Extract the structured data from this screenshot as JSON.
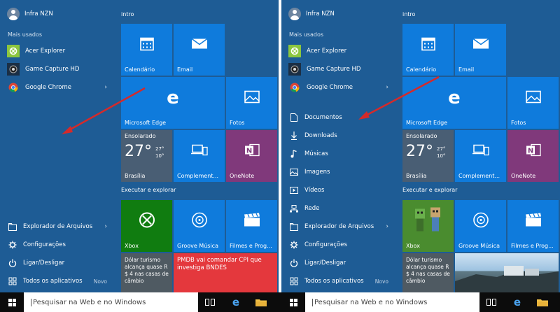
{
  "user": {
    "name": "Infra NZN"
  },
  "most_used_label": "Mais usados",
  "apps": [
    {
      "label": "Acer Explorer",
      "icon": "acer-explorer-icon",
      "color": "#8cc63f"
    },
    {
      "label": "Game Capture HD",
      "icon": "game-capture-icon",
      "color": "#1a1a1a"
    },
    {
      "label": "Google Chrome",
      "icon": "chrome-icon",
      "color": "#ffffff"
    }
  ],
  "chevron": "›",
  "places": [
    {
      "label": "Documentos",
      "icon": "document-icon"
    },
    {
      "label": "Downloads",
      "icon": "download-icon"
    },
    {
      "label": "Músicas",
      "icon": "music-icon"
    },
    {
      "label": "Imagens",
      "icon": "image-icon"
    },
    {
      "label": "Vídeos",
      "icon": "video-icon"
    },
    {
      "label": "Rede",
      "icon": "network-icon"
    }
  ],
  "bottom_menu": {
    "file_explorer": "Explorador de Arquivos",
    "settings": "Configurações",
    "power": "Ligar/Desligar",
    "all_apps": "Todos os aplicativos",
    "new_tag": "Novo"
  },
  "tile_groups": {
    "intro": "intro",
    "explore": "Executar e explorar"
  },
  "tiles": {
    "calendar": "Calendário",
    "email": "Email",
    "edge": "Microsoft Edge",
    "photos": "Fotos",
    "complement": "Complement...",
    "onenote": "OneNote",
    "xbox": "Xbox",
    "groove": "Groove Música",
    "movies": "Filmes e Prog...",
    "weather": {
      "condition": "Ensolarado",
      "temp": "27°",
      "high": "27°",
      "low": "10°",
      "city": "Brasília"
    },
    "news_dollar": "Dólar turismo alcança quase R $ 4 nas casas de câmbio",
    "news_pmdb": "PMDB vai comandar CPI que investiga BNDES"
  },
  "search": {
    "placeholder": "Pesquisar na Web e no Windows"
  },
  "colors": {
    "background": "#1e5c95",
    "tile_blue": "#0f7bdc",
    "xbox_green": "#107c10",
    "onenote_purple": "#80397b",
    "news_red": "#e4383d",
    "arrow_red": "#d52a2a"
  }
}
